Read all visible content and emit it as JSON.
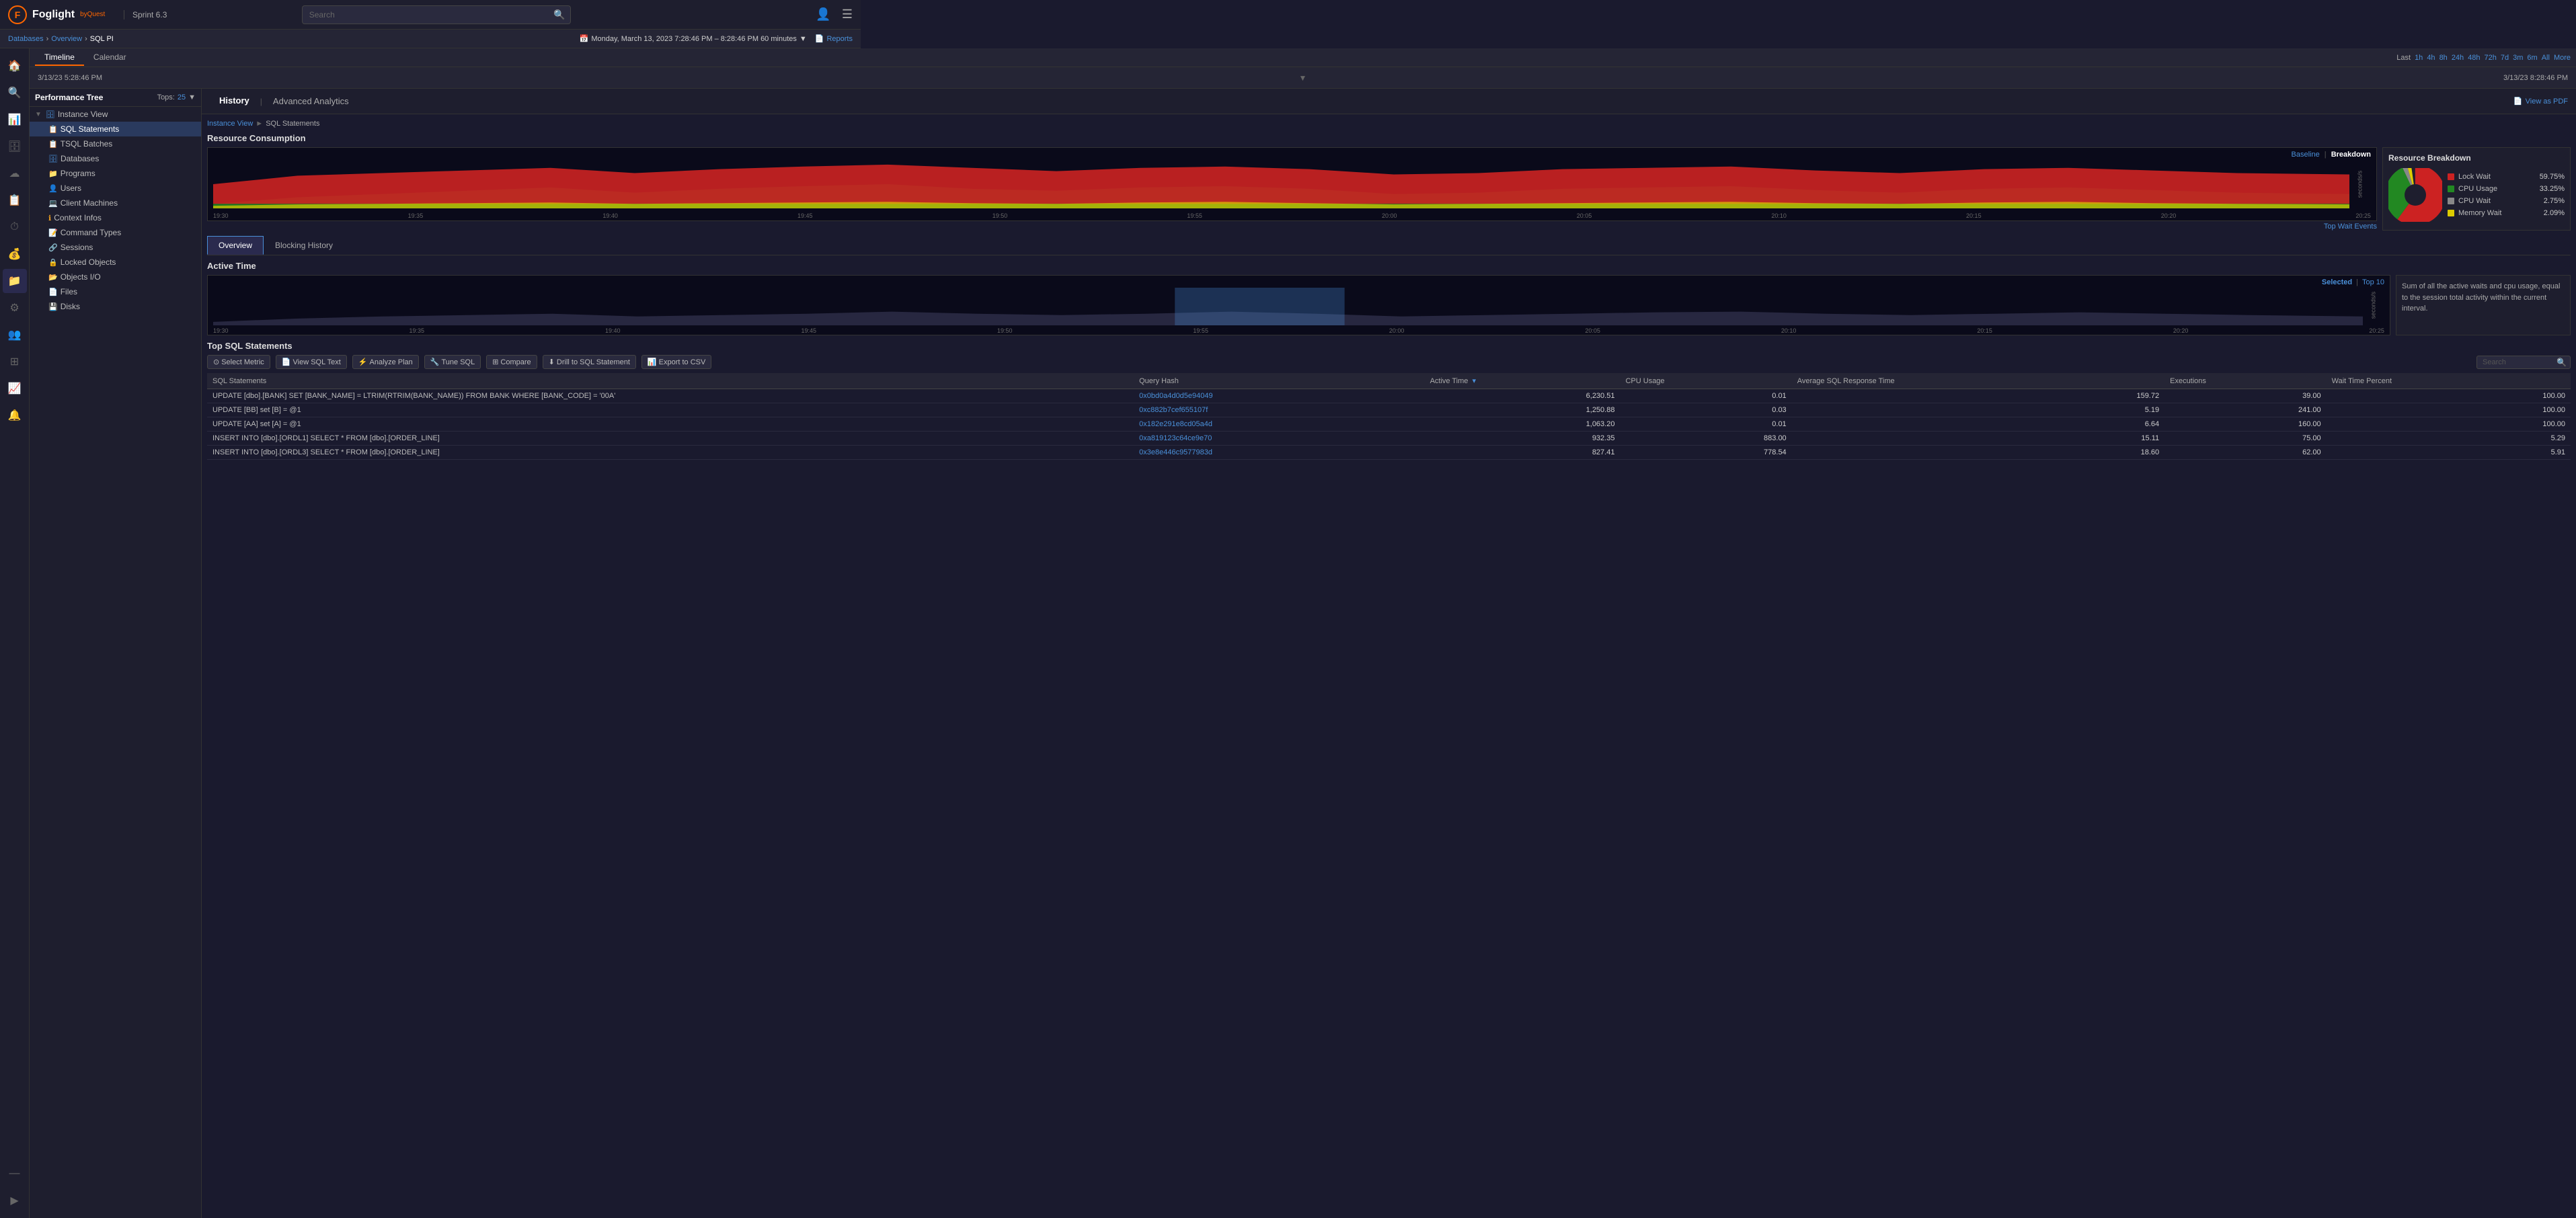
{
  "topbar": {
    "logo_text": "Foglight",
    "by_quest": "byQuest",
    "sprint": "Sprint 6.3",
    "search_placeholder": "Search"
  },
  "breadcrumb": {
    "databases": "Databases",
    "overview": "Overview",
    "current": "SQL PI"
  },
  "time_range": {
    "label": "Monday, March 13, 2023 7:28:46 PM – 8:28:46 PM 60 minutes",
    "calendar_icon": "📅"
  },
  "reports": {
    "label": "Reports"
  },
  "timeline_tabs": {
    "timeline": "Timeline",
    "calendar": "Calendar"
  },
  "time_shortcuts": {
    "last": "Last",
    "items": [
      "1h",
      "4h",
      "8h",
      "24h",
      "48h",
      "72h",
      "7d",
      "3m",
      "6m",
      "All",
      "More"
    ]
  },
  "range": {
    "left": "3/13/23 5:28:46 PM",
    "right": "3/13/23 8:28:46 PM"
  },
  "perf_tree": {
    "title": "Performance Tree",
    "tops_label": "Tops:",
    "tops_value": "25",
    "items": [
      {
        "label": "Instance View",
        "level": 0,
        "icon": "▼",
        "db_icon": "🗄"
      },
      {
        "label": "SQL Statements",
        "level": 1,
        "icon": "",
        "db_icon": "📋",
        "active": true
      },
      {
        "label": "TSQL Batches",
        "level": 1,
        "icon": "",
        "db_icon": "📋"
      },
      {
        "label": "Databases",
        "level": 1,
        "icon": "",
        "db_icon": "🗄"
      },
      {
        "label": "Programs",
        "level": 1,
        "icon": "",
        "db_icon": "📁"
      },
      {
        "label": "Users",
        "level": 1,
        "icon": "",
        "db_icon": "👤"
      },
      {
        "label": "Client Machines",
        "level": 1,
        "icon": "",
        "db_icon": "💻"
      },
      {
        "label": "Context Infos",
        "level": 1,
        "icon": "",
        "db_icon": "ℹ"
      },
      {
        "label": "Command Types",
        "level": 1,
        "icon": "",
        "db_icon": "📝"
      },
      {
        "label": "Sessions",
        "level": 1,
        "icon": "",
        "db_icon": "🔗"
      },
      {
        "label": "Locked Objects",
        "level": 1,
        "icon": "",
        "db_icon": "🔒"
      },
      {
        "label": "Objects I/O",
        "level": 1,
        "icon": "",
        "db_icon": "📂"
      },
      {
        "label": "Files",
        "level": 1,
        "icon": "",
        "db_icon": "📄"
      },
      {
        "label": "Disks",
        "level": 1,
        "icon": "",
        "db_icon": "💾"
      }
    ]
  },
  "panel": {
    "history_label": "History",
    "analytics_label": "Advanced Analytics",
    "view_pdf_label": "View as PDF",
    "breadcrumb_instance": "Instance View",
    "breadcrumb_sql": "SQL Statements"
  },
  "resource_section": {
    "title": "Resource Consumption",
    "top_wait_events": "Top Wait Events",
    "baseline_label": "Baseline",
    "breakdown_label": "Breakdown",
    "chart_times": [
      "19:30",
      "19:35",
      "19:40",
      "19:45",
      "19:50",
      "19:55",
      "20:00",
      "20:05",
      "20:10",
      "20:15",
      "20:20",
      "20:25"
    ],
    "resource_breakdown": {
      "title": "Resource Breakdown",
      "items": [
        {
          "label": "Lock Wait",
          "value": "59.75%",
          "color": "#cc2222"
        },
        {
          "label": "CPU Usage",
          "value": "33.25%",
          "color": "#22aa22"
        },
        {
          "label": "CPU Wait",
          "value": "2.75%",
          "color": "#aaaaaa"
        },
        {
          "label": "Memory Wait",
          "value": "2.09%",
          "color": "#ddcc00"
        }
      ]
    }
  },
  "sub_tabs": {
    "overview": "Overview",
    "blocking_history": "Blocking History"
  },
  "active_time": {
    "title": "Active Time",
    "selected_label": "Selected",
    "top10_label": "Top 10",
    "info_text": "Sum of all the active waits and cpu usage, equal to the session total activity within the current interval.",
    "chart_times": [
      "19:30",
      "19:35",
      "19:40",
      "19:45",
      "19:50",
      "19:55",
      "20:00",
      "20:05",
      "20:10",
      "20:15",
      "20:20",
      "20:25"
    ]
  },
  "sql_table": {
    "title": "Top SQL Statements",
    "toolbar": [
      {
        "label": "Select Metric",
        "icon": "⊙"
      },
      {
        "label": "View SQL Text",
        "icon": "📄"
      },
      {
        "label": "Analyze Plan",
        "icon": "⚡"
      },
      {
        "label": "Tune SQL",
        "icon": "🔧"
      },
      {
        "label": "Compare",
        "icon": "⊞"
      },
      {
        "label": "Drill to SQL Statement",
        "icon": "⬇"
      },
      {
        "label": "Export to CSV",
        "icon": "📊"
      }
    ],
    "search_placeholder": "Search",
    "columns": [
      "SQL Statements",
      "Query Hash",
      "Active Time ▾",
      "CPU Usage",
      "Average SQL Response Time",
      "Executions",
      "Wait Time Percent"
    ],
    "rows": [
      {
        "sql": "UPDATE [dbo].[BANK] SET [BANK_NAME] = LTRIM(RTRIM(BANK_NAME)) FROM BANK WHERE [BANK_CODE] = '00A'",
        "hash": "0x0bd0a4d0d5e94049",
        "active_time": "6,230.51",
        "cpu_usage": "0.01",
        "avg_response": "159.72",
        "executions": "39.00",
        "wait_pct": "100.00"
      },
      {
        "sql": "UPDATE [BB] set [B] = @1",
        "hash": "0xc882b7cef655107f",
        "active_time": "1,250.88",
        "cpu_usage": "0.03",
        "avg_response": "5.19",
        "executions": "241.00",
        "wait_pct": "100.00"
      },
      {
        "sql": "UPDATE [AA] set [A] = @1",
        "hash": "0x182e291e8cd05a4d",
        "active_time": "1,063.20",
        "cpu_usage": "0.01",
        "avg_response": "6.64",
        "executions": "160.00",
        "wait_pct": "100.00"
      },
      {
        "sql": "INSERT INTO [dbo].[ORDL1] SELECT * FROM [dbo].[ORDER_LINE]",
        "hash": "0xa819123c64ce9e70",
        "active_time": "932.35",
        "cpu_usage": "883.00",
        "avg_response": "15.11",
        "executions": "75.00",
        "wait_pct": "5.29"
      },
      {
        "sql": "INSERT INTO [dbo].[ORDL3] SELECT * FROM [dbo].[ORDER_LINE]",
        "hash": "0x3e8e446c9577983d",
        "active_time": "827.41",
        "cpu_usage": "778.54",
        "avg_response": "18.60",
        "executions": "62.00",
        "wait_pct": "5.91"
      }
    ]
  }
}
